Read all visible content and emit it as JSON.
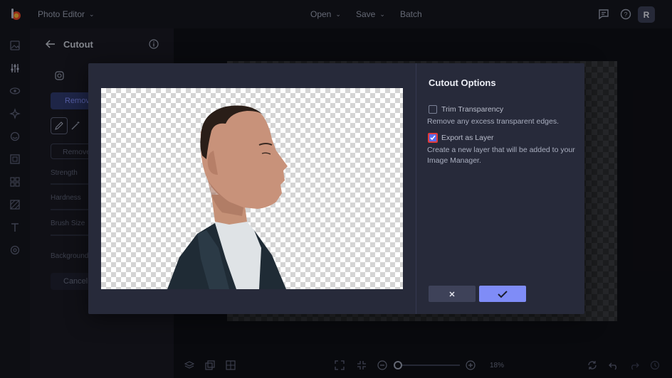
{
  "topbar": {
    "app_name": "Photo Editor",
    "menu": [
      "Open",
      "Save",
      "Batch"
    ],
    "avatar_initial": "R",
    "icons": [
      "feedback-icon",
      "help-icon"
    ]
  },
  "panel": {
    "title": "Cutout",
    "remove_tab": "Remov",
    "remove_button": "Remove",
    "strength_label": "Strength",
    "hardness_label": "Hardness",
    "brush_size_label": "Brush Size",
    "background_label": "Background",
    "cancel_label": "Cancel"
  },
  "bottom": {
    "zoom": "18%"
  },
  "modal": {
    "title": "Cutout Options",
    "options": [
      {
        "label": "Trim Transparency",
        "checked": false,
        "description": "Remove any excess transparent edges."
      },
      {
        "label": "Export as Layer",
        "checked": true,
        "description": "Create a new layer that will be added to your Image Manager."
      }
    ]
  },
  "colors": {
    "accent": "#7f8cf7",
    "modal_bg": "#272a3a",
    "app_bg": "#101118"
  }
}
